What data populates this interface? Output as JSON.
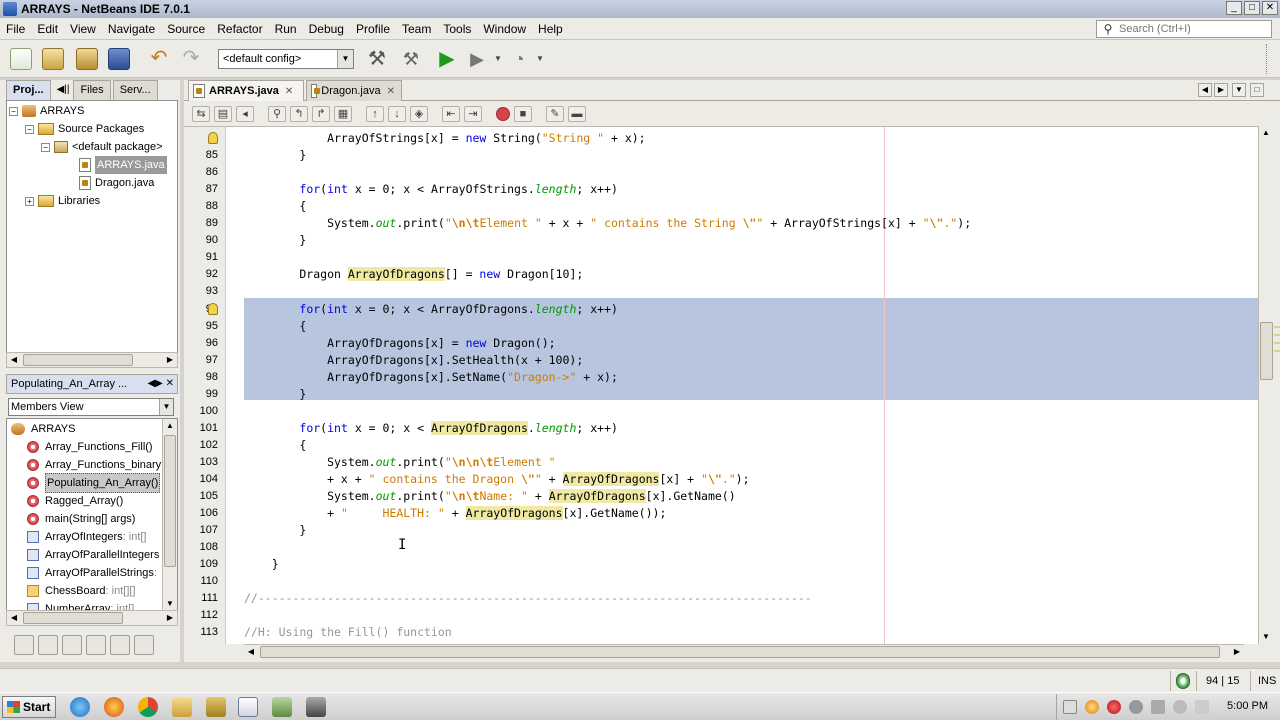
{
  "window": {
    "title": "ARRAYS - NetBeans IDE 7.0.1",
    "controls": [
      "_",
      "□",
      "✕"
    ]
  },
  "menu": [
    "File",
    "Edit",
    "View",
    "Navigate",
    "Source",
    "Refactor",
    "Run",
    "Debug",
    "Profile",
    "Team",
    "Tools",
    "Window",
    "Help"
  ],
  "search": {
    "placeholder": "Search (Ctrl+I)"
  },
  "toolbar": {
    "config": "<default config>"
  },
  "left": {
    "tabs": [
      "Proj...",
      "Files",
      "Serv..."
    ],
    "tree": [
      {
        "label": "ARRAYS",
        "icon": "project-icon"
      },
      {
        "label": "Source Packages",
        "icon": "folder-icon"
      },
      {
        "label": "<default package>",
        "icon": "package-icon"
      },
      {
        "label": "ARRAYS.java",
        "icon": "java-file-icon"
      },
      {
        "label": "Dragon.java",
        "icon": "java-file-icon"
      },
      {
        "label": "Libraries",
        "icon": "folder-icon"
      }
    ],
    "navigator_title": "Populating_An_Array ...",
    "members_view": "Members View",
    "members": [
      {
        "label": "ARRAYS",
        "type": "",
        "icon": "class-icon"
      },
      {
        "label": "Array_Functions_Fill()",
        "type": "",
        "icon": "method-icon"
      },
      {
        "label": "Array_Functions_binary",
        "type": "",
        "icon": "method-icon"
      },
      {
        "label": "Populating_An_Array()",
        "type": "",
        "icon": "method-icon"
      },
      {
        "label": "Ragged_Array()",
        "type": "",
        "icon": "method-icon"
      },
      {
        "label": "main",
        "type": "(String[] args)",
        "icon": "method-icon"
      },
      {
        "label": "ArrayOfIntegers",
        "type": " : int[]",
        "icon": "field-icon"
      },
      {
        "label": "ArrayOfParallelIntegers",
        "type": "",
        "icon": "field-icon"
      },
      {
        "label": "ArrayOfParallelStrings",
        "type": " :",
        "icon": "field-icon"
      },
      {
        "label": "ChessBoard",
        "type": " : int[][]",
        "icon": "chessboard-icon"
      },
      {
        "label": "NumberArray",
        "type": " : int[]",
        "icon": "field-icon"
      }
    ]
  },
  "editor": {
    "tabs": [
      {
        "label": "ARRAYS.java",
        "active": true,
        "close": "✕"
      },
      {
        "label": "Dragon.java",
        "active": false,
        "close": "✕"
      }
    ],
    "lines": [
      {
        "n": "",
        "code": [
          [
            "",
            "            ArrayOfStrings[x] = "
          ],
          [
            "kw",
            "new"
          ],
          [
            "",
            " String("
          ],
          [
            "str",
            "\"String \""
          ],
          [
            "",
            " + x);"
          ]
        ]
      },
      {
        "n": "85",
        "code": [
          [
            "",
            "        }"
          ]
        ]
      },
      {
        "n": "86",
        "code": [
          [
            "",
            ""
          ]
        ]
      },
      {
        "n": "87",
        "code": [
          [
            "",
            "        "
          ],
          [
            "kw",
            "for"
          ],
          [
            "",
            "("
          ],
          [
            "kw",
            "int"
          ],
          [
            "",
            " x = 0; x < ArrayOfStrings."
          ],
          [
            "fld",
            "length"
          ],
          [
            "",
            "; x++)"
          ]
        ]
      },
      {
        "n": "88",
        "code": [
          [
            "",
            "        {"
          ]
        ]
      },
      {
        "n": "89",
        "code": [
          [
            "",
            "            System."
          ],
          [
            "fld",
            "out"
          ],
          [
            "",
            ".print("
          ],
          [
            "str",
            "\""
          ],
          [
            "esc",
            "\\n\\t"
          ],
          [
            "str",
            "Element \""
          ],
          [
            "",
            " + x + "
          ],
          [
            "str",
            "\" contains the String "
          ],
          [
            "esc",
            "\\\""
          ],
          [
            "str",
            "\""
          ],
          [
            "",
            " + ArrayOfStrings[x] + "
          ],
          [
            "str",
            "\""
          ],
          [
            "esc",
            "\\\""
          ],
          [
            "str",
            ".\""
          ],
          [
            "",
            ");"
          ]
        ]
      },
      {
        "n": "90",
        "code": [
          [
            "",
            "        }"
          ]
        ]
      },
      {
        "n": "91",
        "code": [
          [
            "",
            ""
          ]
        ]
      },
      {
        "n": "92",
        "code": [
          [
            "",
            "        Dragon "
          ],
          [
            "hl",
            "ArrayOfDragons"
          ],
          [
            "",
            "[] = "
          ],
          [
            "kw",
            "new"
          ],
          [
            "",
            " Dragon[10];"
          ]
        ]
      },
      {
        "n": "93",
        "code": [
          [
            "",
            ""
          ]
        ]
      },
      {
        "n": "94",
        "code": [
          [
            "",
            "        "
          ],
          [
            "kw",
            "for"
          ],
          [
            "",
            "("
          ],
          [
            "kw",
            "int"
          ],
          [
            "",
            " x = 0; x < ArrayOfDragons."
          ],
          [
            "fld",
            "length"
          ],
          [
            "",
            "; x++)"
          ]
        ]
      },
      {
        "n": "95",
        "code": [
          [
            "",
            "        {"
          ]
        ]
      },
      {
        "n": "96",
        "code": [
          [
            "",
            "            ArrayOfDragons[x] = "
          ],
          [
            "kw",
            "new"
          ],
          [
            "",
            " Dragon();"
          ]
        ]
      },
      {
        "n": "97",
        "code": [
          [
            "",
            "            ArrayOfDragons[x].SetHealth(x + 100);"
          ]
        ]
      },
      {
        "n": "98",
        "code": [
          [
            "",
            "            ArrayOfDragons[x].SetName("
          ],
          [
            "str",
            "\"Dragon->\""
          ],
          [
            "",
            " + x);"
          ]
        ]
      },
      {
        "n": "99",
        "code": [
          [
            "",
            "        }"
          ]
        ]
      },
      {
        "n": "100",
        "code": [
          [
            "",
            ""
          ]
        ]
      },
      {
        "n": "101",
        "code": [
          [
            "",
            "        "
          ],
          [
            "kw",
            "for"
          ],
          [
            "",
            "("
          ],
          [
            "kw",
            "int"
          ],
          [
            "",
            " x = 0; x < "
          ],
          [
            "hl",
            "ArrayOfDragons"
          ],
          [
            "",
            "."
          ],
          [
            "fld",
            "length"
          ],
          [
            "",
            "; x++)"
          ]
        ]
      },
      {
        "n": "102",
        "code": [
          [
            "",
            "        {"
          ]
        ]
      },
      {
        "n": "103",
        "code": [
          [
            "",
            "            System."
          ],
          [
            "fld",
            "out"
          ],
          [
            "",
            ".print("
          ],
          [
            "str",
            "\""
          ],
          [
            "esc",
            "\\n\\n\\t"
          ],
          [
            "str",
            "Element \""
          ]
        ]
      },
      {
        "n": "104",
        "code": [
          [
            "",
            "            + x + "
          ],
          [
            "str",
            "\" contains the Dragon "
          ],
          [
            "esc",
            "\\\""
          ],
          [
            "str",
            "\""
          ],
          [
            "",
            " + "
          ],
          [
            "hl",
            "ArrayOfDragons"
          ],
          [
            "",
            "[x] + "
          ],
          [
            "str",
            "\""
          ],
          [
            "esc",
            "\\\""
          ],
          [
            "str",
            ".\""
          ],
          [
            "",
            ");"
          ]
        ]
      },
      {
        "n": "105",
        "code": [
          [
            "",
            "            System."
          ],
          [
            "fld",
            "out"
          ],
          [
            "",
            ".print("
          ],
          [
            "str",
            "\""
          ],
          [
            "esc",
            "\\n\\t"
          ],
          [
            "str",
            "Name: \""
          ],
          [
            "",
            " + "
          ],
          [
            "hl",
            "ArrayOfDragons"
          ],
          [
            "",
            "[x].GetName()"
          ]
        ]
      },
      {
        "n": "106",
        "code": [
          [
            "",
            "            + "
          ],
          [
            "str",
            "\"     HEALTH: \""
          ],
          [
            "",
            " + "
          ],
          [
            "hl",
            "ArrayOfDragons"
          ],
          [
            "",
            "[x].GetName());"
          ]
        ]
      },
      {
        "n": "107",
        "code": [
          [
            "",
            "        }"
          ]
        ]
      },
      {
        "n": "108",
        "code": [
          [
            "",
            ""
          ]
        ]
      },
      {
        "n": "109",
        "code": [
          [
            "",
            "    }"
          ]
        ]
      },
      {
        "n": "110",
        "code": [
          [
            "",
            ""
          ]
        ]
      },
      {
        "n": "111",
        "code": [
          [
            "cmt",
            "//--------------------------------------------------------------------------------"
          ]
        ]
      },
      {
        "n": "112",
        "code": [
          [
            "",
            ""
          ]
        ]
      },
      {
        "n": "113",
        "code": [
          [
            "cmt",
            "//H: Using the Fill() function"
          ]
        ]
      }
    ]
  },
  "status": {
    "position": "94 | 15",
    "mode": "INS"
  },
  "taskbar": {
    "start": "Start",
    "clock": "5:00 PM"
  },
  "colors": {
    "selection": "#b7c5df",
    "keyword": "#0000e6",
    "string": "#ce7b00",
    "field": "#009900",
    "highlight": "#f0e9a4"
  }
}
